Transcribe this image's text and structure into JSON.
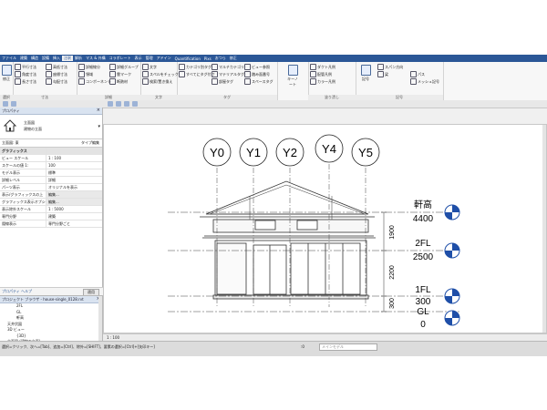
{
  "menu": {
    "tabs": [
      "ファイル",
      "建築",
      "構造",
      "設備",
      "挿入",
      "注釈",
      "解析",
      "マス & 外構",
      "コラボレート",
      "表示",
      "管理",
      "アドイン",
      "Quantification",
      "Pixs",
      "おつら",
      "修正"
    ],
    "active_index": 5
  },
  "ribbon": {
    "select_label": "修正",
    "select_group": "選択",
    "dimension_items": [
      "平行寸法",
      "角度寸法",
      "長さ寸法",
      "径寸法",
      "円弧長寸法"
    ],
    "spot_items": [
      "高低寸法",
      "座標寸法",
      "勾配寸法"
    ],
    "dimension_group": "寸法",
    "detail_items": [
      "詳細線分",
      "領域",
      "コンポーネント",
      "詳細グループ",
      "雲マーク",
      "断熱材"
    ],
    "detail_group": "詳細",
    "text_items": [
      "文字",
      "スペルをチェック",
      "検索/置き換え"
    ],
    "text_group": "文字",
    "tag_items": [
      "カテゴリ別タグ",
      "すべてにタグ付け",
      "マルチカテゴリ",
      "マテリアルタグ",
      "部屋タグ",
      "スペースタグ",
      "ビュー参照",
      "踏み面番号",
      "構成要素"
    ],
    "tag_group": "タグ",
    "keynote_label": "キーノート",
    "color_fill_items": [
      "ダクト凡例",
      "配管凡例",
      "カラー凡例"
    ],
    "color_fill_group": "塗り潰し",
    "symbol_label": "記号",
    "symbol_items": [
      "スパン方向",
      "梁",
      "パス",
      "メッシュ記号"
    ],
    "symbol_group": "記号"
  },
  "properties": {
    "title": "プロパティ",
    "type_line1": "立面図",
    "type_line2": "建物の立面",
    "filter_label": "立面図: 東",
    "filter_edit": "タイプ編集",
    "rows": [
      {
        "k": "グラフィックス",
        "v": "",
        "section": true
      },
      {
        "k": "ビュー スケール",
        "v": "1 : 100"
      },
      {
        "k": "スケールの値 1:",
        "v": "100"
      },
      {
        "k": "モデル表示",
        "v": "標準"
      },
      {
        "k": "詳細レベル",
        "v": "詳細"
      },
      {
        "k": "パーツ表示",
        "v": "オリジナルを表示"
      },
      {
        "k": "表示/グラフィックスの上",
        "v": "編集..."
      },
      {
        "k": "グラフィックス表示オプション",
        "v": "編集..."
      },
      {
        "k": "表示除外スケール",
        "v": "1 : 5000"
      },
      {
        "k": "専門分野",
        "v": "建築"
      },
      {
        "k": "隠線表示",
        "v": "専門分野ごと"
      }
    ],
    "help_link": "プロパティ ヘルプ",
    "apply": "適用"
  },
  "browser": {
    "title": "プロジェクト ブラウザ - house-single_0128.rvt",
    "items": [
      "2FL",
      "GL",
      "軒高",
      "天井伏図",
      "3D ビュー",
      "{3D}",
      "立面図 (建物の立面)",
      "北",
      "東",
      "南",
      "西",
      "凡例",
      "集計表/数量"
    ]
  },
  "drawing": {
    "grids": [
      "Y0",
      "Y1",
      "Y2",
      "Y4",
      "Y5"
    ],
    "levels": [
      {
        "name": "軒高",
        "value": "4400"
      },
      {
        "name": "2FL",
        "value": "2500"
      },
      {
        "name": "1FL",
        "value": "300"
      },
      {
        "name": "GL",
        "value": "0"
      }
    ],
    "dims": [
      "1900",
      "2200",
      "300"
    ]
  },
  "view_control": {
    "scale": "1 : 100"
  },
  "status": {
    "message": "選択=クリック、次へ=[Tab]、追加=[Ctrl]、除外=[SHIFT]、要素の選択=[Ctrl]+[矢印キー]",
    "workset": "メインモデル",
    "zero": ":0"
  }
}
